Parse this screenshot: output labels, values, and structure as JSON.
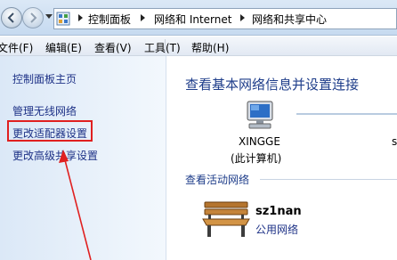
{
  "address_bar": {
    "crumbs": [
      "控制面板",
      "网络和 Internet",
      "网络和共享中心"
    ]
  },
  "menu": {
    "items": [
      "文件(F)",
      "编辑(E)",
      "查看(V)",
      "工具(T)",
      "帮助(H)"
    ]
  },
  "left_nav": {
    "items": [
      "控制面板主页",
      "管理无线网络",
      "更改适配器设置",
      "更改高级共享设置"
    ]
  },
  "main": {
    "heading": "查看基本网络信息并设置连接",
    "computer": {
      "name": "XINGGE",
      "label": "(此计算机)"
    },
    "partial_next_item": "s",
    "active_section": "查看活动网络",
    "active_network": {
      "name": "sz1nan",
      "type": "公用网络"
    }
  },
  "colors": {
    "highlight_box": "#e02020",
    "arrow": "#e02020",
    "link": "#1e3287",
    "heading": "#1e3d8a"
  },
  "icons": [
    "back-arrow-icon",
    "forward-arrow-icon",
    "dropdown-arrow-icon",
    "control-panel-icon",
    "breadcrumb-separator-icon",
    "computer-icon",
    "bench-icon"
  ]
}
